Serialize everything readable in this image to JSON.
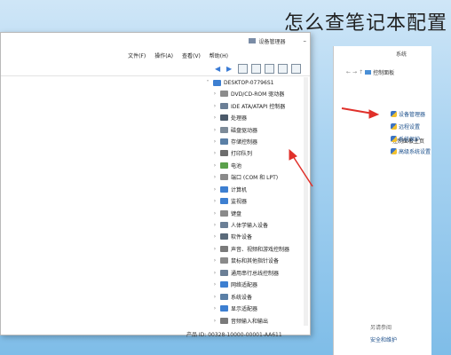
{
  "overlay_title": "怎么查笔记本配置",
  "system_window": {
    "title": "系统",
    "address": "控制面板",
    "home_label": "控制面板主页",
    "links": [
      "设备管理器",
      "远程设置",
      "系统保护",
      "高级系统设置"
    ],
    "bottom_links": [
      "另请参阅",
      "安全和维护"
    ]
  },
  "device_manager": {
    "title": "设备管理器",
    "menu": [
      "文件(F)",
      "操作(A)",
      "查看(V)",
      "帮助(H)"
    ],
    "root": "DESKTOP-07796S1",
    "devices": [
      {
        "label": "DVD/CD-ROM 驱动器",
        "color": "#8c8c8c"
      },
      {
        "label": "IDE ATA/ATAPI 控制器",
        "color": "#6b7f96"
      },
      {
        "label": "处理器",
        "color": "#4b5a6a"
      },
      {
        "label": "磁盘驱动器",
        "color": "#7d8b99"
      },
      {
        "label": "存储控制器",
        "color": "#5a7fa6"
      },
      {
        "label": "打印队列",
        "color": "#6d6d6d"
      },
      {
        "label": "电池",
        "color": "#5aa04b"
      },
      {
        "label": "端口 (COM 和 LPT)",
        "color": "#8a8a8a"
      },
      {
        "label": "计算机",
        "color": "#3d7fd1"
      },
      {
        "label": "监视器",
        "color": "#3d7fd1"
      },
      {
        "label": "键盘",
        "color": "#8a8a8a"
      },
      {
        "label": "人体学输入设备",
        "color": "#6b7f96"
      },
      {
        "label": "软件设备",
        "color": "#5a6a7a"
      },
      {
        "label": "声音、视频和游戏控制器",
        "color": "#7a7a7a"
      },
      {
        "label": "鼠标和其他指针设备",
        "color": "#8a8a8a"
      },
      {
        "label": "通用串行总线控制器",
        "color": "#6b7f96"
      },
      {
        "label": "网络适配器",
        "color": "#3d7fd1"
      },
      {
        "label": "系统设备",
        "color": "#5a7fa6"
      },
      {
        "label": "显示适配器",
        "color": "#3d7fd1"
      },
      {
        "label": "音频输入和输出",
        "color": "#7a7a7a"
      }
    ]
  },
  "product_id": "产品 ID: 00328-10000-00001-AA611"
}
